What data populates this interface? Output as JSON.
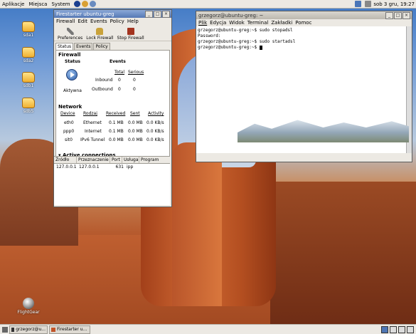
{
  "top_panel": {
    "menus": [
      "Aplikacje",
      "Miejsca",
      "System"
    ],
    "clock": "sob  3 gru, 19:27"
  },
  "desktop_icons": [
    {
      "label": "sda1"
    },
    {
      "label": "sda2"
    },
    {
      "label": "sdb1"
    },
    {
      "label": "sdb5"
    },
    {
      "label": "FlightGear"
    }
  ],
  "firestarter": {
    "title": "Firestarter ubuntu-greg",
    "menus": [
      "Firewall",
      "Edit",
      "Events",
      "Policy",
      "Help"
    ],
    "toolbar": {
      "preferences": "Preferences",
      "lock": "Lock Firewall",
      "stop": "Stop Firewall"
    },
    "tabs": [
      "Status",
      "Events",
      "Policy"
    ],
    "firewall_heading": "Firewall",
    "status_header": "Status",
    "events_header": "Events",
    "total_header": "Total",
    "serious_header": "Serious",
    "status_value": "Aktywna",
    "inbound_label": "Inbound",
    "outbound_label": "Outbound",
    "inbound_total": "0",
    "inbound_serious": "0",
    "outbound_total": "0",
    "outbound_serious": "0",
    "network_heading": "Network",
    "net_cols": [
      "Device",
      "Rodzaj",
      "Received",
      "Sent",
      "Activity"
    ],
    "net_rows": [
      [
        "eth0",
        "Ethernet",
        "0.1 MB",
        "0.0 MB",
        "0.0 KB/s"
      ],
      [
        "ppp0",
        "Internet",
        "0.1 MB",
        "0.0 MB",
        "0.0 KB/s"
      ],
      [
        "sit0",
        "IPv6 Tunnel",
        "0.0 MB",
        "0.0 MB",
        "0.0 KB/s"
      ]
    ],
    "active_heading": "Active connections",
    "conn_cols": [
      "Źródło",
      "Przeznaczenie",
      "Port",
      "Usługa",
      "Program"
    ],
    "conn_rows": [
      [
        "127.0.0.1",
        "127.0.0.1",
        "631",
        "ipp",
        ""
      ]
    ]
  },
  "terminal": {
    "title": "grzegorz@ubuntu-greg: ~",
    "menus": [
      "Plik",
      "Edycja",
      "Widok",
      "Terminal",
      "Zakładki",
      "Pomoc"
    ],
    "lines": [
      "grzegorz@ubuntu-greg:~$ sudo stopadsl",
      "Password:",
      "grzegorz@ubuntu-greg:~$ sudo startadsl",
      "grzegorz@ubuntu-greg:~$ "
    ]
  },
  "taskbar": {
    "items": [
      "grzegorz@u...",
      "Firestarter u..."
    ]
  }
}
